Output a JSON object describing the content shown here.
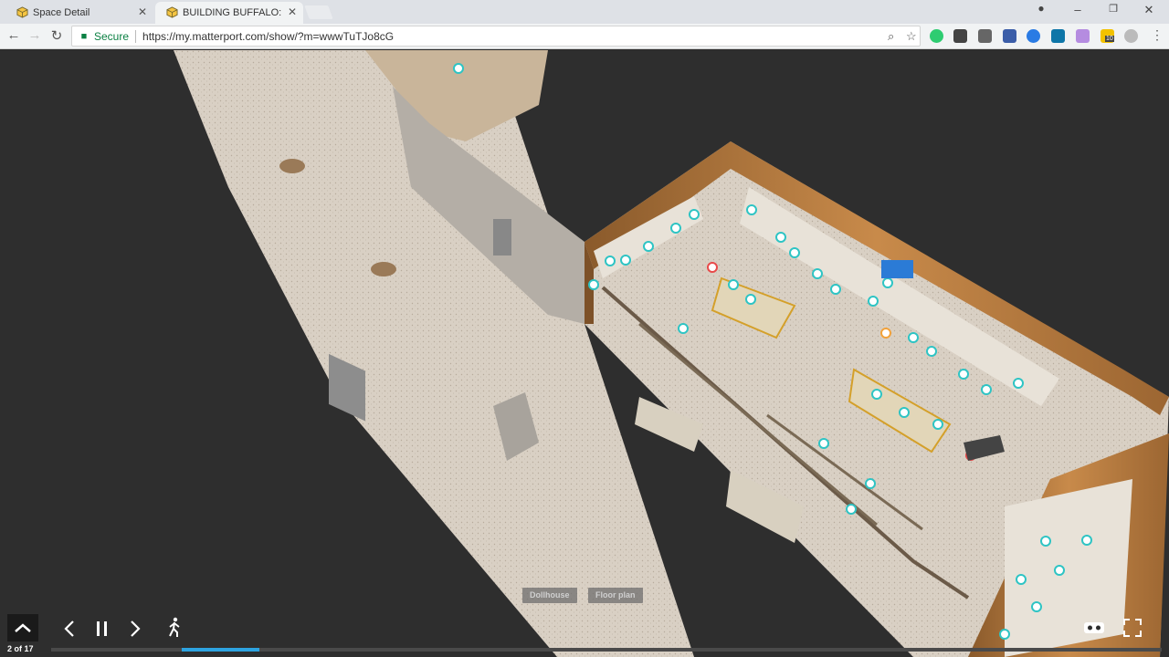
{
  "tabs": [
    {
      "label": "Space Detail",
      "active": false
    },
    {
      "label": "BUILDING BUFFALO: Buil",
      "active": true
    }
  ],
  "omnibox": {
    "secure_label": "Secure",
    "url": "https://my.matterport.com/show/?m=wwwTuTJo8cG"
  },
  "extensions_badge": "10",
  "viewer": {
    "mode_buttons": [
      "Dollhouse",
      "Floor plan"
    ],
    "counter": "2 of 17",
    "progress": 0.07
  },
  "colors": {
    "accent": "#2da3e0",
    "tag_teal": "#2ec4c4",
    "tag_red": "#e84a4a",
    "tag_orange": "#f2a23a",
    "secure_green": "#0b8043"
  },
  "icons": {
    "up": "chevron-up-icon",
    "prev": "chevron-left-icon",
    "pause": "pause-icon",
    "next": "chevron-right-icon",
    "walk": "walk-person-icon",
    "vr": "vr-headset-icon",
    "fullscreen": "fullscreen-icon"
  }
}
